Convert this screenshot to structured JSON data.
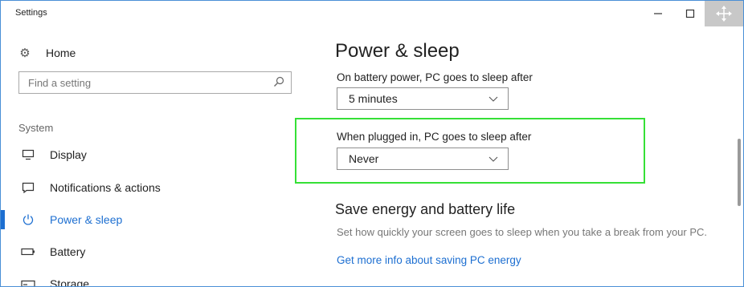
{
  "window": {
    "title": "Settings",
    "controls": {
      "minimize": "—",
      "maximize": "☐",
      "close": "✥"
    }
  },
  "sidebar": {
    "home_label": "Home",
    "search": {
      "placeholder": "Find a setting",
      "value": ""
    },
    "section_label": "System",
    "items": [
      {
        "label": "Display",
        "icon": "monitor-icon",
        "active": false
      },
      {
        "label": "Notifications & actions",
        "icon": "message-icon",
        "active": false
      },
      {
        "label": "Power & sleep",
        "icon": "power-icon",
        "active": true
      },
      {
        "label": "Battery",
        "icon": "battery-icon",
        "active": false
      },
      {
        "label": "Storage",
        "icon": "storage-icon",
        "active": false
      }
    ]
  },
  "main": {
    "title": "Power & sleep",
    "battery_sleep": {
      "label": "On battery power, PC goes to sleep after",
      "value": "5 minutes"
    },
    "plugged_sleep": {
      "label": "When plugged in, PC goes to sleep after",
      "value": "Never"
    },
    "save_energy": {
      "heading": "Save energy and battery life",
      "description": "Set how quickly your screen goes to sleep when you take a break from your PC.",
      "link": "Get more info about saving PC energy"
    }
  },
  "colors": {
    "accent": "#1d6fd1",
    "highlight": "#35e036",
    "window_border": "#4a8fd6"
  }
}
